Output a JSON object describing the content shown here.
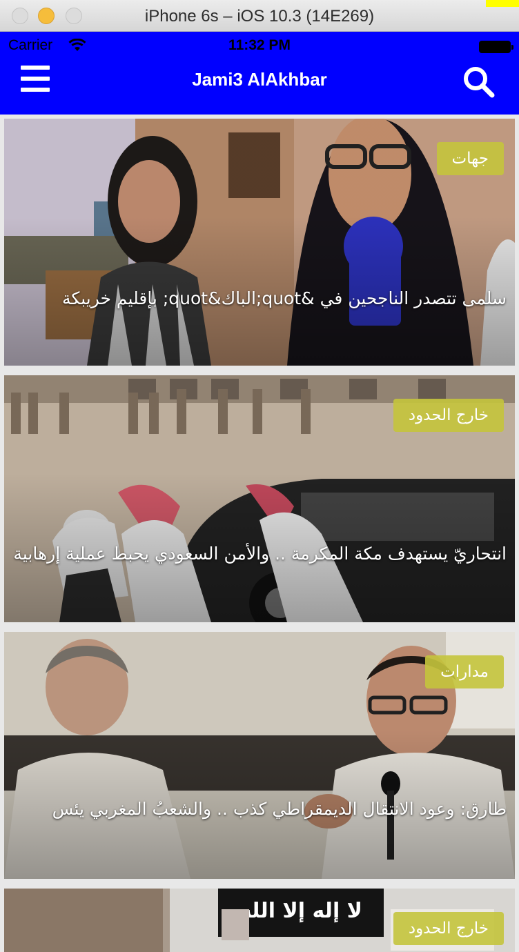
{
  "window": {
    "title": "iPhone 6s – iOS 10.3 (14E269)"
  },
  "status_bar": {
    "carrier": "Carrier",
    "time": "11:32 PM"
  },
  "navbar": {
    "title": "Jami3 AlAkhbar",
    "menu_icon": "hamburger-icon",
    "search_icon": "search-icon"
  },
  "colors": {
    "navbar_bg": "#0000ff",
    "badge_bg": "#c4c43c",
    "text_on_image": "#ffffff"
  },
  "articles": [
    {
      "category": "جهات",
      "headline": "سلمى تتصدر الناجحين في &quot;الباك&quot; بإقليم خريبكة"
    },
    {
      "category": "خارج الحدود",
      "headline": "انتحاريّ يستهدف مكة المكرمة .. والأمن السعودي يحبط عملية إرهابية"
    },
    {
      "category": "مدارات",
      "headline": "طارق: وعود الانتقال الديمقراطي كذب .. والشعبُ المغربي يئس"
    },
    {
      "category": "خارج الحدود",
      "headline": ""
    }
  ]
}
